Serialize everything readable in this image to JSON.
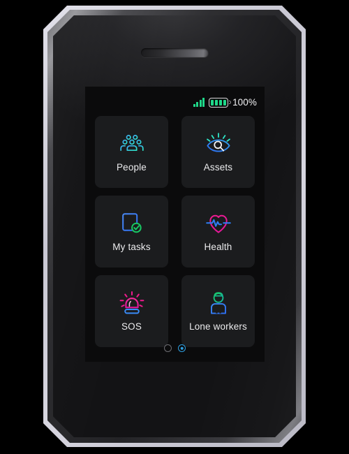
{
  "device": {
    "name": "rugged-handheld-device",
    "speaker_label": "earpiece-speaker"
  },
  "screen": {
    "status_bar": {
      "signal_icon": "signal-bars-icon",
      "signal_bars": 4,
      "signal_bars_total": 4,
      "battery_icon": "battery-icon",
      "battery_segments": 4,
      "battery_segments_total": 4,
      "battery_percent_label": "100%",
      "accent_color": "#1fd98a"
    },
    "tiles": [
      {
        "label": "People",
        "icon": "people-group-icon",
        "icon_colors": [
          "#3ea9f5",
          "#2ee6c8"
        ]
      },
      {
        "label": "Assets",
        "icon": "eye-search-icon",
        "icon_colors": [
          "#2e6ff5",
          "#2ee6c8"
        ]
      },
      {
        "label": "My tasks",
        "icon": "task-checklist-icon",
        "icon_colors": [
          "#3a7bf7",
          "#18c964"
        ]
      },
      {
        "label": "Health",
        "icon": "heart-pulse-icon",
        "icon_colors": [
          "#f01b8e",
          "#2e7ef5"
        ]
      },
      {
        "label": "SOS",
        "icon": "alarm-siren-icon",
        "icon_colors": [
          "#f01b8e",
          "#3a8bf7"
        ]
      },
      {
        "label": "Lone workers",
        "icon": "hard-hat-worker-icon",
        "icon_colors": [
          "#18c964",
          "#3a8bf7"
        ]
      }
    ],
    "pagination": {
      "pages": 2,
      "active_page": 2,
      "active_color": "#2e9fe0",
      "inactive_color": "#6d6d72"
    },
    "background_color": "#0b0b0c",
    "tile_color": "#1b1c1e",
    "label_color": "#ececee"
  }
}
